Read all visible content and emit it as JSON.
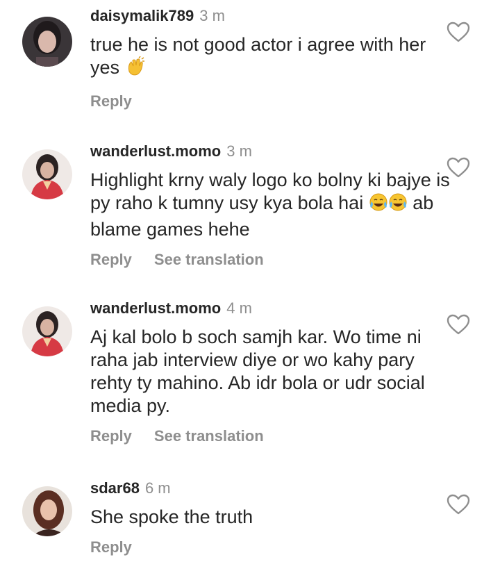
{
  "comments": [
    {
      "username": "daisymalik789",
      "time": "3 m",
      "text_a": "true he is not good actor i agree with her yes ",
      "emoji_after": "waving-hands-emoji",
      "text_b": "",
      "reply": "Reply",
      "translation": ""
    },
    {
      "username": "wanderlust.momo",
      "time": "3 m",
      "text_a": "Highlight krny waly logo ko bolny ki bajye is py raho k tumny usy kya bola hai ",
      "emoji_after": "tears-of-joy-emoji",
      "text_b": " ab blame games hehe",
      "reply": "Reply",
      "translation": "See translation"
    },
    {
      "username": "wanderlust.momo",
      "time": "4 m",
      "text_a": "Aj kal bolo b soch samjh kar. Wo time ni raha jab interview diye or wo kahy pary rehty ty mahino. Ab idr bola or udr social media py.",
      "emoji_after": "",
      "text_b": "",
      "reply": "Reply",
      "translation": "See translation"
    },
    {
      "username": "sdar68",
      "time": "6 m",
      "text_a": "She spoke the truth",
      "emoji_after": "",
      "text_b": "",
      "reply": "Reply",
      "translation": ""
    }
  ],
  "colors": {
    "text": "#262626",
    "secondary": "#8e8e8e",
    "background": "#ffffff"
  },
  "icons": {
    "like": "heart-outline-icon"
  }
}
